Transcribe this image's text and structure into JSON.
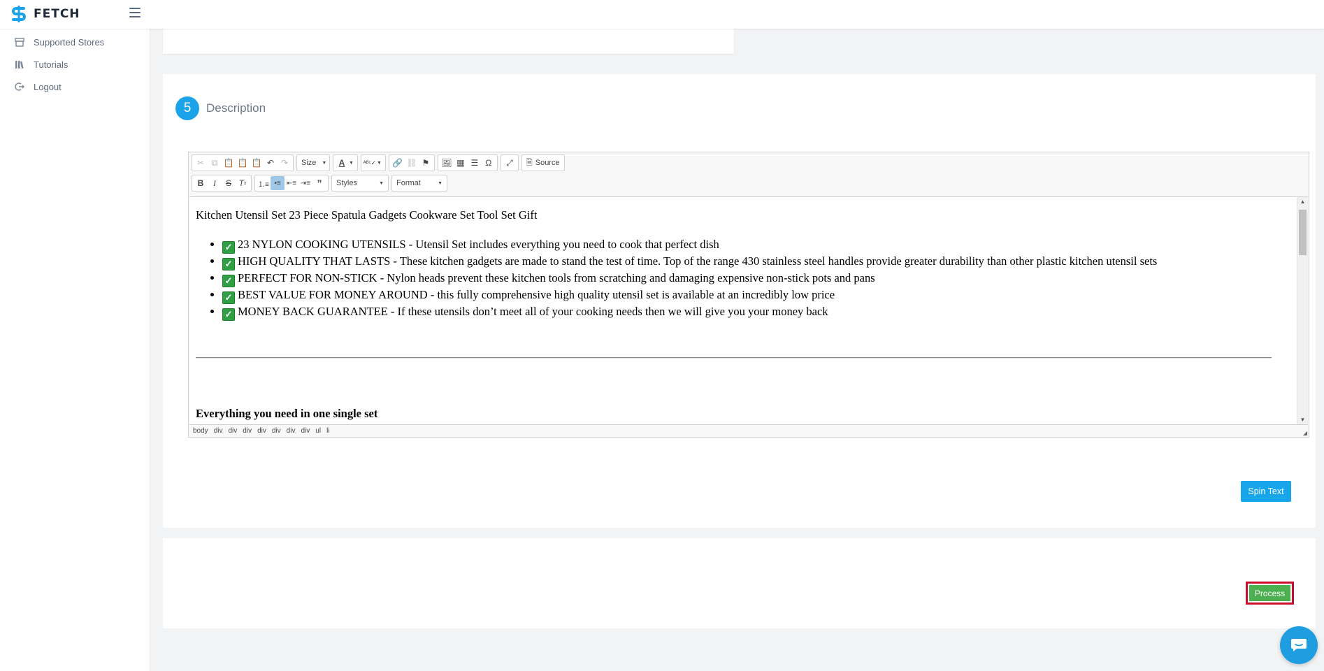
{
  "app": {
    "name": "FETCH",
    "brand_color": "#1aa3e8"
  },
  "sidebar": {
    "items": [
      {
        "label": "Supported Stores",
        "icon": "store-icon"
      },
      {
        "label": "Tutorials",
        "icon": "books-icon"
      },
      {
        "label": "Logout",
        "icon": "logout-icon"
      }
    ]
  },
  "section": {
    "step_number": "5",
    "title": "Description"
  },
  "editor": {
    "toolbar": {
      "size_label": "Size",
      "styles_label": "Styles",
      "format_label": "Format",
      "source_label": "Source"
    },
    "content": {
      "title": "Kitchen Utensil Set 23 Piece Spatula Gadgets Cookware Set Tool Set Gift",
      "bullets": [
        {
          "heading": "23 NYLON COOKING UTENSILS - ",
          "text": "Utensil Set includes everything you need to cook that perfect dish"
        },
        {
          "heading": "HIGH QUALITY THAT LASTS - ",
          "text": "These kitchen gadgets are made to stand the test of time. Top of the range 430 stainless steel handles provide greater durability than other plastic kitchen utensil sets"
        },
        {
          "heading": "PERFECT FOR NON-STICK - ",
          "text": "Nylon heads prevent these kitchen tools from scratching and damaging expensive non-stick pots and pans"
        },
        {
          "heading": "BEST VALUE FOR MONEY AROUND - ",
          "text": "this fully comprehensive high quality utensil set is available at an incredibly low price"
        },
        {
          "heading": "MONEY BACK GUARANTEE - ",
          "text": "If these utensils don’t meet all of your cooking needs then we will give you your money back"
        }
      ],
      "subheading": "Everything you need in one single set"
    },
    "path": [
      "body",
      "div",
      "div",
      "div",
      "div",
      "div",
      "div",
      "div",
      "ul",
      "li"
    ]
  },
  "buttons": {
    "spin_text": "Spin Text",
    "process": "Process"
  },
  "colors": {
    "primary": "#17a6ea",
    "success": "#4caf50",
    "highlight_border": "#c8102e"
  }
}
